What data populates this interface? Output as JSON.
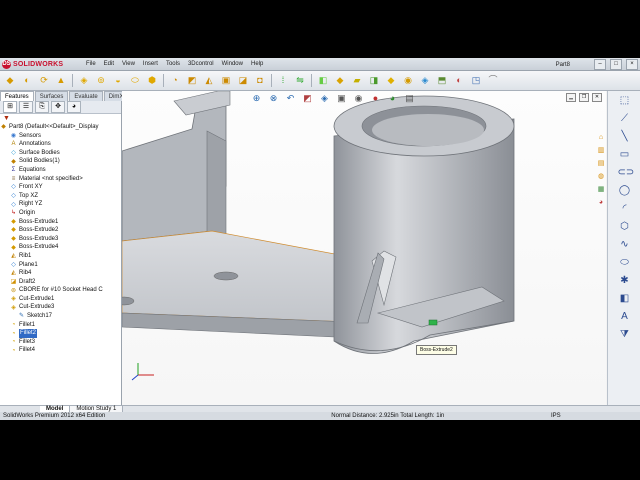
{
  "app": {
    "brand": "SOLIDWORKS",
    "logo_mark": "DS",
    "document_title": "Part8",
    "menus": [
      "File",
      "Edit",
      "View",
      "Insert",
      "Tools",
      "3Dcontrol",
      "Window",
      "Help"
    ],
    "window_buttons": [
      "–",
      "□",
      "×"
    ]
  },
  "command_manager": {
    "tabs": [
      {
        "label": "Features",
        "active": true
      },
      {
        "label": "Surfaces",
        "active": false
      },
      {
        "label": "Evaluate",
        "active": false
      },
      {
        "label": "DimXpert",
        "active": false
      }
    ]
  },
  "feature_tree": {
    "root": "Part8 (Default<<Default>_Display",
    "items": [
      {
        "label": "Sensors",
        "icon": "sensor-icon"
      },
      {
        "label": "Annotations",
        "icon": "annotations-icon"
      },
      {
        "label": "Surface Bodies",
        "icon": "surface-bodies-icon"
      },
      {
        "label": "Solid Bodies(1)",
        "icon": "solid-bodies-icon"
      },
      {
        "label": "Equations",
        "icon": "equations-icon"
      },
      {
        "label": "Material <not specified>",
        "icon": "material-icon"
      },
      {
        "label": "Front XY",
        "icon": "plane-icon"
      },
      {
        "label": "Top XZ",
        "icon": "plane-icon"
      },
      {
        "label": "Right YZ",
        "icon": "plane-icon"
      },
      {
        "label": "Origin",
        "icon": "origin-icon"
      },
      {
        "label": "Boss-Extrude1",
        "icon": "boss-extrude-icon"
      },
      {
        "label": "Boss-Extrude2",
        "icon": "boss-extrude-icon"
      },
      {
        "label": "Boss-Extrude3",
        "icon": "boss-extrude-icon"
      },
      {
        "label": "Boss-Extrude4",
        "icon": "boss-extrude-icon"
      },
      {
        "label": "Rib1",
        "icon": "rib-icon"
      },
      {
        "label": "Plane1",
        "icon": "plane-icon"
      },
      {
        "label": "Rib4",
        "icon": "rib-icon"
      },
      {
        "label": "Draft2",
        "icon": "draft-icon"
      },
      {
        "label": "CBORE for #10 Socket Head C",
        "icon": "hole-wizard-icon"
      },
      {
        "label": "Cut-Extrude1",
        "icon": "cut-extrude-icon"
      },
      {
        "label": "Cut-Extrude3",
        "icon": "cut-extrude-icon"
      },
      {
        "label": "Sketch17",
        "icon": "sketch-icon"
      },
      {
        "label": "Fillet1",
        "icon": "fillet-icon"
      },
      {
        "label": "Fillet2",
        "icon": "fillet-icon",
        "selected": true
      },
      {
        "label": "Fillet3",
        "icon": "fillet-icon"
      },
      {
        "label": "Fillet4",
        "icon": "fillet-icon"
      }
    ]
  },
  "viewport": {
    "tooltip": "Boss-Extrude2",
    "model_color": "#c5c8ce"
  },
  "bottom_tabs": [
    {
      "label": "Model",
      "active": true
    },
    {
      "label": "Motion Study 1",
      "active": false
    }
  ],
  "status": {
    "edition": "SolidWorks Premium 2012 x64 Edition",
    "measure": "Normal Distance: 2.925in Total Length: 1in",
    "units": "IPS"
  }
}
